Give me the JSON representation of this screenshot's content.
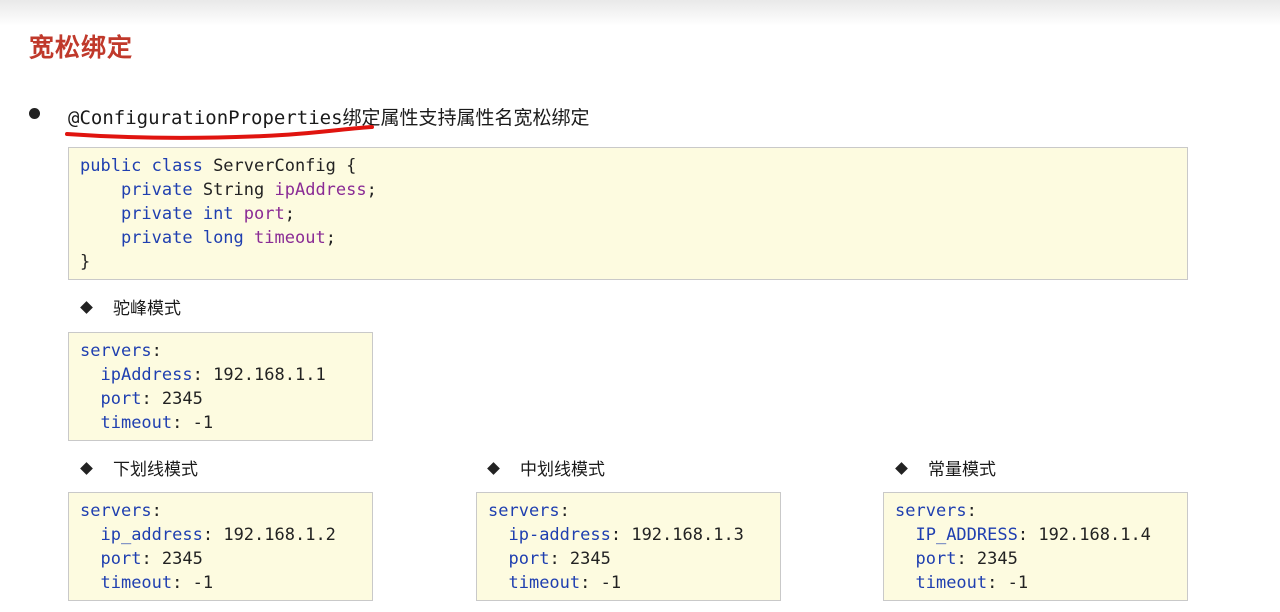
{
  "slide": {
    "title": "宽松绑定",
    "bullet_annotation": "@ConfigurationProperties",
    "bullet_text": "绑定属性支持属性名宽松绑定"
  },
  "java_code": {
    "line1": {
      "kw": "public class",
      "rest": " ServerConfig {"
    },
    "line2": {
      "kw": "private",
      "type": " String ",
      "field": "ipAddress",
      "end": ";"
    },
    "line3": {
      "kw": "private int",
      "field": "port",
      "end": ";"
    },
    "line4": {
      "kw": "private long",
      "field": "timeout",
      "end": ";"
    },
    "line5": "}"
  },
  "modes": [
    {
      "label": "驼峰模式",
      "root": "servers",
      "entries": [
        {
          "key": "ipAddress",
          "value": "192.168.1.1"
        },
        {
          "key": "port",
          "value": "2345"
        },
        {
          "key": "timeout",
          "value": "-1"
        }
      ]
    },
    {
      "label": "下划线模式",
      "root": "servers",
      "entries": [
        {
          "key": "ip_address",
          "value": "192.168.1.2"
        },
        {
          "key": "port",
          "value": "2345"
        },
        {
          "key": "timeout",
          "value": "-1"
        }
      ]
    },
    {
      "label": "中划线模式",
      "root": "servers",
      "entries": [
        {
          "key": "ip-address",
          "value": "192.168.1.3"
        },
        {
          "key": "port",
          "value": "2345"
        },
        {
          "key": "timeout",
          "value": "-1"
        }
      ]
    },
    {
      "label": "常量模式",
      "root": "servers",
      "entries": [
        {
          "key": "IP_ADDRESS",
          "value": "192.168.1.4"
        },
        {
          "key": "port",
          "value": "2345"
        },
        {
          "key": "timeout",
          "value": "-1"
        }
      ]
    }
  ],
  "colors": {
    "title": "#c0392b",
    "code_background": "#fdfbe0",
    "keyword": "#1f3fb0",
    "field": "#8a2b95",
    "annotation_underline": "#e0140f"
  }
}
